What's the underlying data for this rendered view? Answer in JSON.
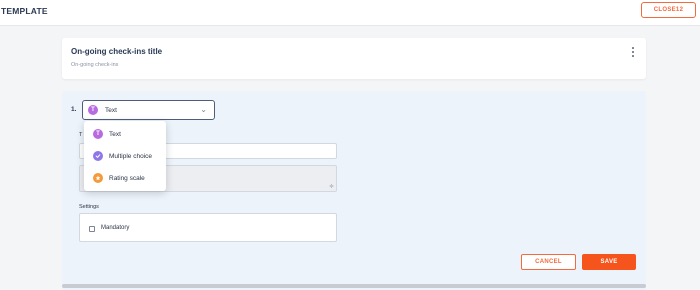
{
  "header": {
    "title": "TEMPLATE",
    "close_label": "CLOSE12"
  },
  "title_card": {
    "title": "On-going check-ins title",
    "subtitle": "On-going check-ins"
  },
  "question": {
    "number": "1.",
    "type_selected": "Text",
    "type_icon": "T",
    "field_label": "T",
    "settings_label": "Settings",
    "mandatory_label": "Mandatory"
  },
  "type_menu": {
    "items": [
      {
        "label": "Text",
        "icon": "text-type-icon"
      },
      {
        "label": "Multiple choice",
        "icon": "check-icon"
      },
      {
        "label": "Rating scale",
        "icon": "star-icon"
      }
    ]
  },
  "actions": {
    "cancel_label": "CANCEL",
    "save_label": "SAVE"
  },
  "colors": {
    "accent": "#f26a3d",
    "save_bg": "#f5541d",
    "text_badge": "#b86be0",
    "multi_badge": "#9077e8",
    "rating_badge": "#f59a3a"
  }
}
